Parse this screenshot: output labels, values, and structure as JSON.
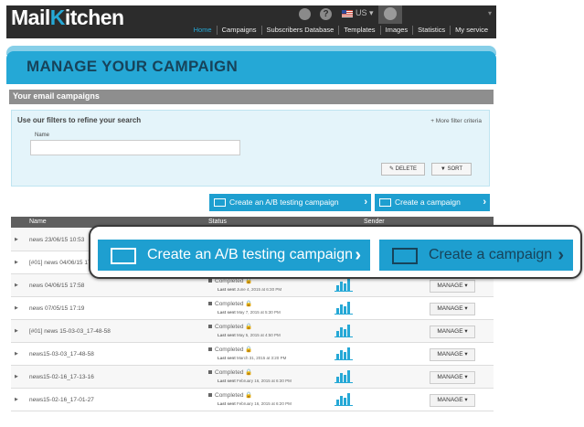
{
  "app": {
    "logo_main": "Mail",
    "logo_k": "K",
    "logo_rest": "itchen"
  },
  "topbar": {
    "language": "US",
    "help_glyph": "?",
    "caret": "▾"
  },
  "nav": [
    "Home",
    "Campaigns",
    "Subscribers Database",
    "Templates",
    "Images",
    "Statistics",
    "My service"
  ],
  "page_title": "MANAGE YOUR CAMPAIGN",
  "section_title": "Your email campaigns",
  "filter": {
    "title": "Use our filters to refine your search",
    "more": "+ More filter criteria",
    "name_label": "Name",
    "name_value": "",
    "delete_label": "✎ DELETE",
    "sort_label": "▼ SORT"
  },
  "actions": {
    "ab_label": "Create an A/B testing campaign",
    "campaign_label": "Create a campaign",
    "chevron": "›"
  },
  "table": {
    "headers": {
      "name": "Name",
      "status": "Status",
      "sender": "Sender"
    },
    "rows": [
      {
        "name": "news 23/06/15 10:53",
        "status": "",
        "last_sent_label": "",
        "last_sent": "",
        "manage": ""
      },
      {
        "name": "[#01] news 04/06/15 17",
        "status": "",
        "last_sent_label": "",
        "last_sent": "",
        "manage": ""
      },
      {
        "name": "news 04/06/15 17:58",
        "status": "Completed 🔒",
        "last_sent_label": "Last sent",
        "last_sent": "June 4, 2015 at 6:30 PM",
        "manage": "MANAGE ▾"
      },
      {
        "name": "news 07/05/15 17:19",
        "status": "Completed 🔒",
        "last_sent_label": "Last sent",
        "last_sent": "May 7, 2015 at 5:30 PM",
        "manage": "MANAGE ▾"
      },
      {
        "name": "[#01] news 15-03-03_17-48-58",
        "status": "Completed 🔒",
        "last_sent_label": "Last sent",
        "last_sent": "May 5, 2015 at 4:50 PM",
        "manage": "MANAGE ▾"
      },
      {
        "name": "news15-03-03_17-48-58",
        "status": "Completed 🔒",
        "last_sent_label": "Last sent",
        "last_sent": "March 31, 2015 at 3:20 PM",
        "manage": "MANAGE ▾"
      },
      {
        "name": "news15-02-16_17-13-16",
        "status": "Completed 🔒",
        "last_sent_label": "Last sent",
        "last_sent": "February 16, 2015 at 6:30 PM",
        "manage": "MANAGE ▾"
      },
      {
        "name": "news15-02-16_17-01-27",
        "status": "Completed 🔒",
        "last_sent_label": "Last sent",
        "last_sent": "February 16, 2015 at 6:20 PM",
        "manage": "MANAGE ▾"
      }
    ]
  },
  "colors": {
    "brand": "#25a8d6",
    "dark_text": "#17435a",
    "topbar": "#2c2c2c"
  }
}
